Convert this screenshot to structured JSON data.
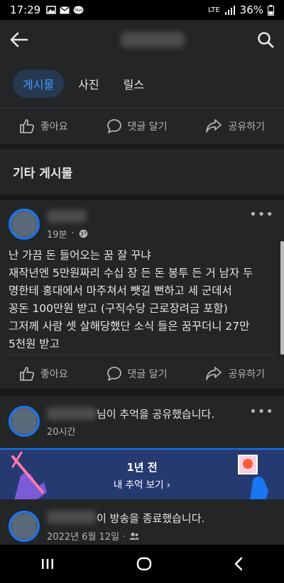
{
  "status_bar": {
    "time": "17:29",
    "network": "LTE",
    "battery": "36%",
    "icons": [
      "gallery-icon",
      "email-icon",
      "talk-icon",
      "signal-icon",
      "battery-icon"
    ]
  },
  "header": {
    "back_icon": "arrow-left-icon",
    "search_icon": "search-icon"
  },
  "tabs": [
    {
      "label": "게시물",
      "active": true
    },
    {
      "label": "사진",
      "active": false
    },
    {
      "label": "릴스",
      "active": false
    }
  ],
  "actions": {
    "like": "좋아요",
    "comment": "댓글 달기",
    "share": "공유하기"
  },
  "section_title": "기타 게시물",
  "post1": {
    "time": "19분",
    "text_lines": [
      "난 가끔 돈 들어오는 꿈 잘 꾸냐",
      "재작년엔 5만원짜리 수십 장 든 돈 봉투 든 거 남자 두",
      "명한테 홍대에서 마주쳐서 뺏길 뻔하고 세 군데서",
      "꽁돈 100만원 받고 (구직수당 근로장려금 포함)",
      "그저께 사람 셋 살해당했단 소식 들은 꿈꾸더니 27만",
      "5천원 받고"
    ]
  },
  "post2": {
    "title_suffix": "님이 추억을 공유했습니다.",
    "time": "20시간"
  },
  "memory": {
    "title": "1년 전",
    "link": "내 추억 보기 ›"
  },
  "post3": {
    "title_suffix": "이 방송을 종료했습니다.",
    "date": "2022년 6월 12일 ·"
  },
  "colors": {
    "accent": "#1877f2",
    "background": "#18191a",
    "card": "#242526",
    "active_tab": "#4599ff"
  }
}
